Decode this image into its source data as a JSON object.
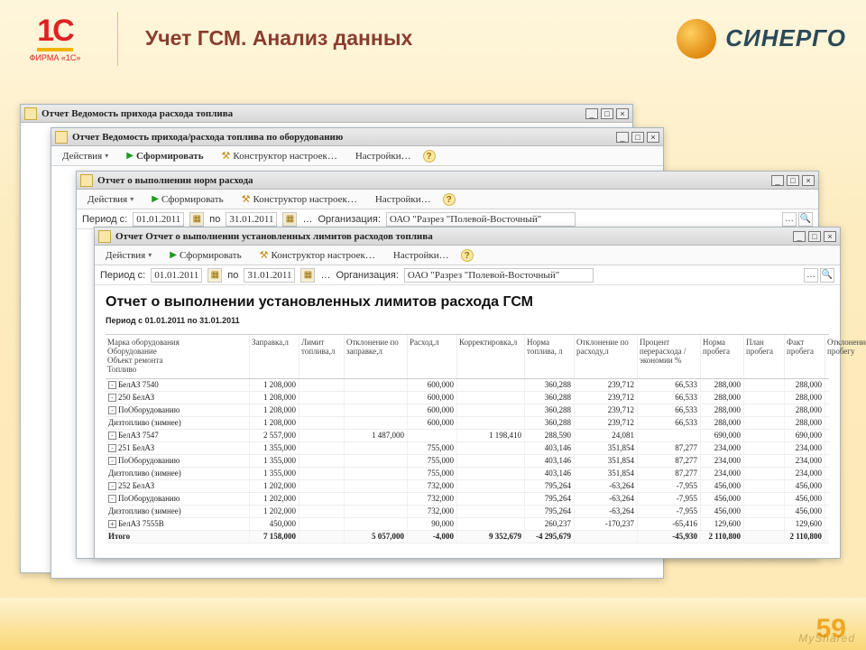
{
  "header": {
    "logo_upper": "1C",
    "logo_lower": "ФИРМА «1С»",
    "title": "Учет ГСМ. Анализ данных",
    "brand": "СИНЕРГО"
  },
  "page_number": "59",
  "watermark": "MyShared",
  "windows": {
    "w1": {
      "title": "Отчет  Ведомость прихода расхода топлива"
    },
    "w2": {
      "title": "Отчет  Ведомость прихода/расхода топлива по оборудованию",
      "actions": "Действия",
      "form": "Сформировать",
      "constructor": "Конструктор настроек…",
      "settings": "Настройки…"
    },
    "w3": {
      "title": "Отчет о выполнении норм расхода",
      "actions": "Действия",
      "form": "Сформировать",
      "constructor": "Конструктор настроек…",
      "settings": "Настройки…",
      "period_label": "Период с:",
      "date_from": "01.01.2011",
      "date_to_label": "по",
      "date_to": "31.01.2011",
      "org_label": "Организация:",
      "org": "ОАО \"Разрез \"Полевой-Восточный\""
    },
    "w4": {
      "title": "Отчет  Отчет о выполнении установленных лимитов расходов топлива",
      "actions": "Действия",
      "form": "Сформировать",
      "constructor": "Конструктор настроек…",
      "settings": "Настройки…",
      "period_label": "Период с:",
      "date_from": "01.01.2011",
      "date_to_label": "по",
      "date_to": "31.01.2011",
      "org_label": "Организация:",
      "org": "ОАО \"Разрез \"Полевой-Восточный\"",
      "report_title": "Отчет о выполнении установленных лимитов расхода ГСМ",
      "report_sub": "Период с 01.01.2011 по 31.01.2011",
      "headers": [
        "Марка оборудования\nОборудование\nОбъект ремонта\nТопливо",
        "Заправка,л",
        "Лимит топлива,л",
        "Отклонение по заправке,л",
        "Расход,л",
        "Корректировка,л",
        "Норма топлива, л",
        "Отклонение по расходу,л",
        "Процент перерасхода / экономии %",
        "Норма пробега",
        "План пробега",
        "Факт пробега",
        "Отклонение по пробегу"
      ],
      "rows": [
        {
          "ind": 0,
          "t": "-",
          "label": "БелАЗ 7540",
          "c": [
            "1 208,000",
            "",
            "",
            "600,000",
            "",
            "360,288",
            "239,712",
            "66,533",
            "288,000",
            "",
            "288,000",
            ""
          ]
        },
        {
          "ind": 1,
          "t": "-",
          "label": "250 БелАЗ",
          "c": [
            "1 208,000",
            "",
            "",
            "600,000",
            "",
            "360,288",
            "239,712",
            "66,533",
            "288,000",
            "",
            "288,000",
            ""
          ]
        },
        {
          "ind": 2,
          "t": "-",
          "label": "ПоОборудованию",
          "c": [
            "1 208,000",
            "",
            "",
            "600,000",
            "",
            "360,288",
            "239,712",
            "66,533",
            "288,000",
            "",
            "288,000",
            ""
          ]
        },
        {
          "ind": 3,
          "t": "",
          "label": "Дизтопливо (зимнее)",
          "c": [
            "1 208,000",
            "",
            "",
            "600,000",
            "",
            "360,288",
            "239,712",
            "66,533",
            "288,000",
            "",
            "288,000",
            ""
          ]
        },
        {
          "ind": 0,
          "t": "-",
          "label": "БелАЗ 7547",
          "c": [
            "2 557,000",
            "",
            "1 487,000",
            "",
            "1 198,410",
            "288,590",
            "24,081",
            "",
            "690,000",
            "",
            "690,000",
            ""
          ]
        },
        {
          "ind": 1,
          "t": "-",
          "label": "251 БелАЗ",
          "c": [
            "1 355,000",
            "",
            "",
            "755,000",
            "",
            "403,146",
            "351,854",
            "87,277",
            "234,000",
            "",
            "234,000",
            ""
          ]
        },
        {
          "ind": 2,
          "t": "-",
          "label": "ПоОборудованию",
          "c": [
            "1 355,000",
            "",
            "",
            "755,000",
            "",
            "403,146",
            "351,854",
            "87,277",
            "234,000",
            "",
            "234,000",
            ""
          ]
        },
        {
          "ind": 3,
          "t": "",
          "label": "Дизтопливо (зимнее)",
          "c": [
            "1 355,000",
            "",
            "",
            "755,000",
            "",
            "403,146",
            "351,854",
            "87,277",
            "234,000",
            "",
            "234,000",
            ""
          ]
        },
        {
          "ind": 1,
          "t": "-",
          "label": "252 БелАЗ",
          "c": [
            "1 202,000",
            "",
            "",
            "732,000",
            "",
            "795,264",
            "-63,264",
            "-7,955",
            "456,000",
            "",
            "456,000",
            ""
          ]
        },
        {
          "ind": 2,
          "t": "-",
          "label": "ПоОборудованию",
          "c": [
            "1 202,000",
            "",
            "",
            "732,000",
            "",
            "795,264",
            "-63,264",
            "-7,955",
            "456,000",
            "",
            "456,000",
            ""
          ]
        },
        {
          "ind": 3,
          "t": "",
          "label": "Дизтопливо (зимнее)",
          "c": [
            "1 202,000",
            "",
            "",
            "732,000",
            "",
            "795,264",
            "-63,264",
            "-7,955",
            "456,000",
            "",
            "456,000",
            ""
          ]
        },
        {
          "ind": 0,
          "t": "+",
          "label": "БелАЗ 7555В",
          "c": [
            "450,000",
            "",
            "",
            "90,000",
            "",
            "260,237",
            "-170,237",
            "-65,416",
            "129,600",
            "",
            "129,600",
            ""
          ]
        },
        {
          "ind": 0,
          "t": "",
          "label": "Итого",
          "cls": "itogo",
          "c": [
            "7 158,000",
            "",
            "5 057,000",
            "-4,000",
            "9 352,679",
            "-4 295,679",
            "",
            "-45,930",
            "2 110,800",
            "",
            "2 110,800",
            ""
          ]
        }
      ]
    }
  }
}
